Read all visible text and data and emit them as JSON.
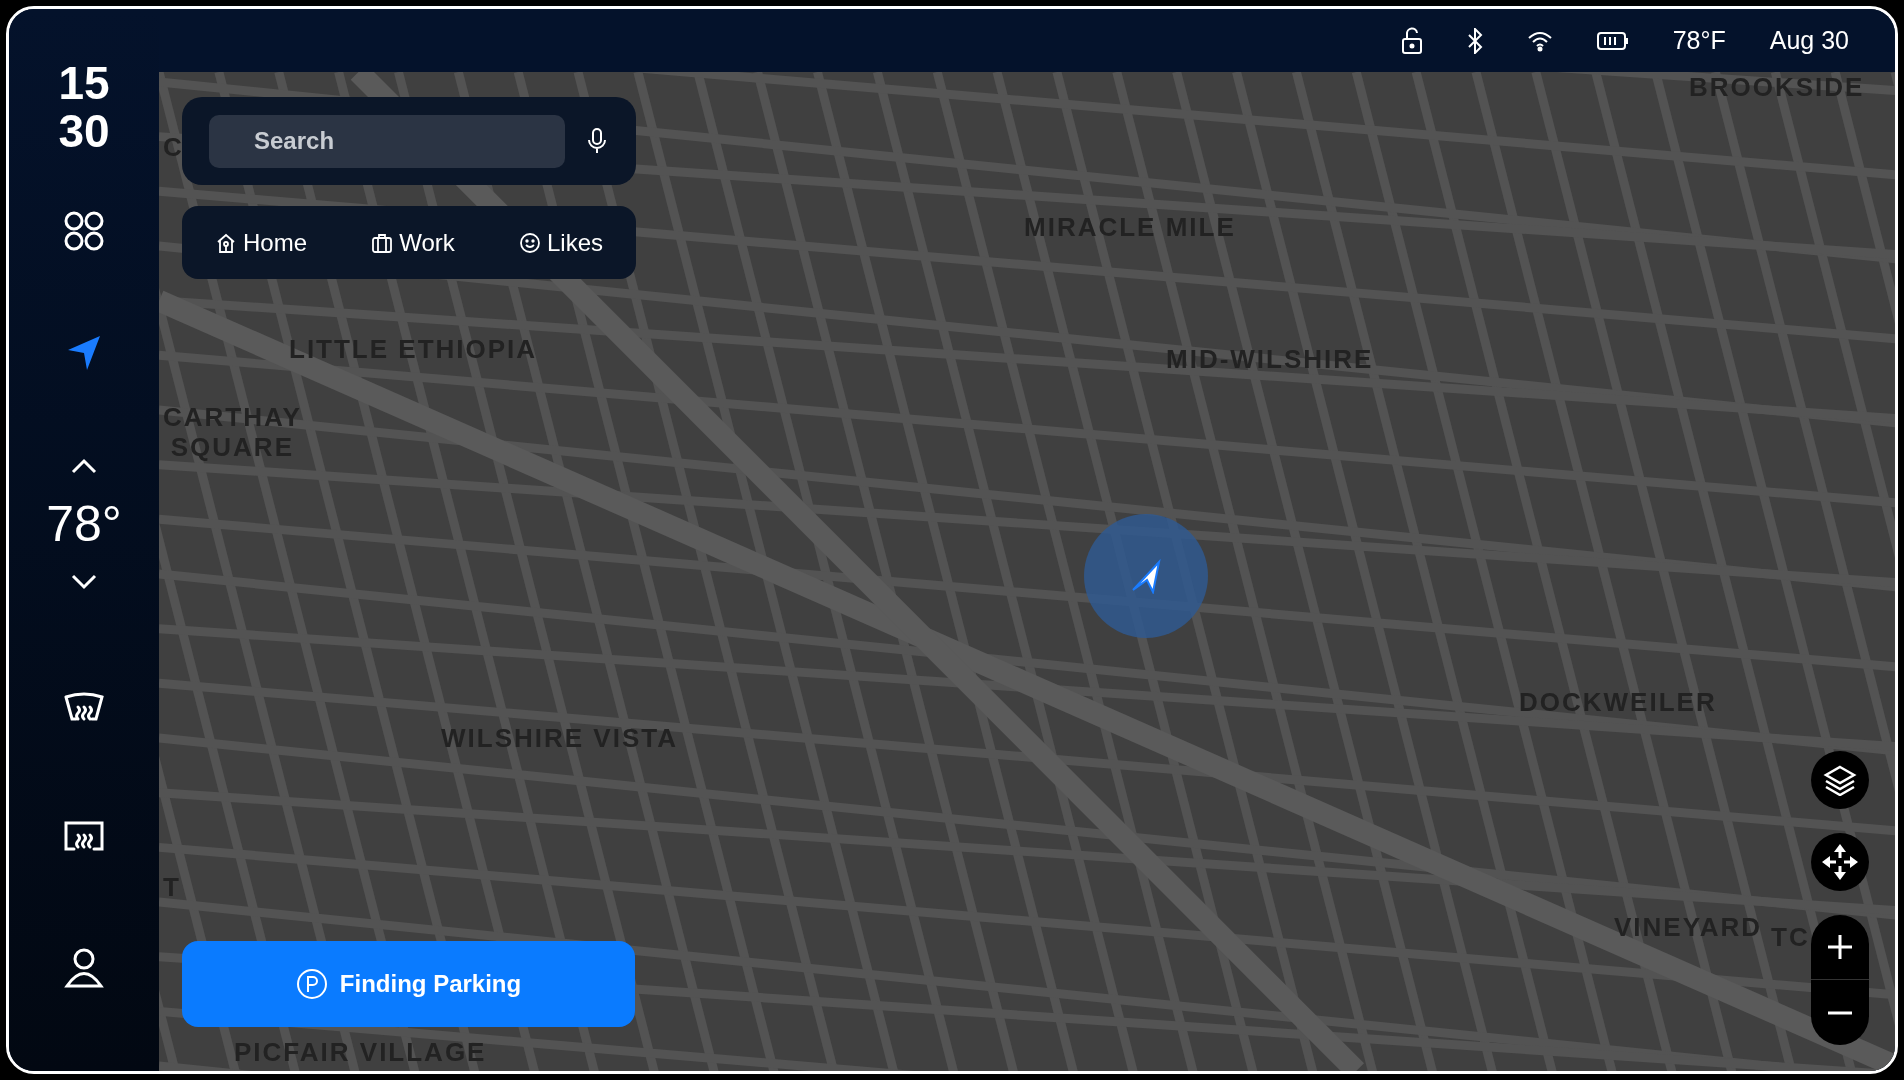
{
  "status_bar": {
    "temperature": "78°F",
    "date": "Aug 30"
  },
  "clock": {
    "hour": "15",
    "minute": "30"
  },
  "sidebar": {
    "items": [
      {
        "kind": "apps",
        "selected": false
      },
      {
        "kind": "navigation",
        "selected": true
      }
    ],
    "climate": {
      "temperature": "78°"
    },
    "bottom_items": [
      {
        "kind": "front-defrost",
        "selected": false
      },
      {
        "kind": "rear-defrost",
        "selected": false
      },
      {
        "kind": "profile",
        "selected": false
      }
    ]
  },
  "search": {
    "placeholder": "Search"
  },
  "shortcuts": [
    {
      "kind": "home",
      "label": "Home"
    },
    {
      "kind": "work",
      "label": "Work"
    },
    {
      "kind": "likes",
      "label": "Likes"
    }
  ],
  "map": {
    "labels": [
      "BROOKSIDE",
      "C",
      "MIRACLE MILE",
      "LITTLE ETHIOPIA",
      "MID-WILSHIRE",
      "CARTHAY\nSQUARE",
      "DOCKWEILER",
      "WILSHIRE VISTA",
      "T",
      "VINEYARD",
      "TC",
      "PICFAIR VILLAGE"
    ]
  },
  "parking_button": {
    "label": "Finding Parking"
  }
}
